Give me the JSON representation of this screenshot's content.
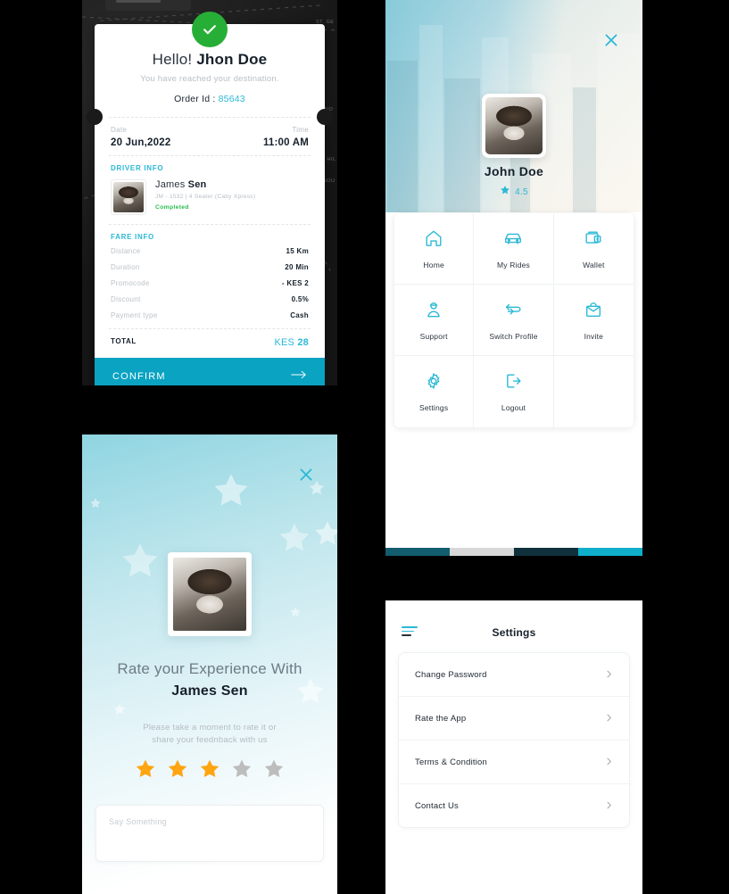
{
  "receipt": {
    "status_icon": "check-circle-icon",
    "greeting_light": "Hello!",
    "greeting_name": "Jhon Doe",
    "subtitle": "You have reached your destination.",
    "order_label": "Order Id :",
    "order_value": "85643",
    "date_label": "Date",
    "date_value": "20 Jun,2022",
    "time_label": "Time",
    "time_value": "11:00 AM",
    "driver_section_title": "DRIVER INFO",
    "driver_first": "James",
    "driver_last": "Sen",
    "driver_meta": "JM - 1532  |  4 Seater (Caby Xpress)",
    "driver_status": "Completed",
    "fare_section_title": "FARE INFO",
    "fare_rows": [
      {
        "label": "Distance",
        "value": "15 Km"
      },
      {
        "label": "Duration",
        "value": "20 Min"
      },
      {
        "label": "Promocode",
        "value": "- KES  2"
      },
      {
        "label": "Discount",
        "value": "0.5%"
      },
      {
        "label": "Payment type",
        "value": "Cash"
      }
    ],
    "total_label": "TOTAL",
    "total_currency": "KES",
    "total_amount": "28",
    "confirm_label": "CONFIRM",
    "map_labels": [
      "ST. GE",
      "N HIL",
      "SOU",
      "NO"
    ],
    "accent_color": "#2bb8d6",
    "confirm_bg": "#0aa3c2",
    "success_color": "#27ae36"
  },
  "profile": {
    "close_icon": "close-icon",
    "avatar_name": "avatar",
    "name": "John Doe",
    "rating_icon": "star-icon",
    "rating": "4.5",
    "menu": [
      {
        "icon": "home-icon",
        "label": "Home"
      },
      {
        "icon": "car-icon",
        "label": "My Rides"
      },
      {
        "icon": "wallet-icon",
        "label": "Wallet"
      },
      {
        "icon": "support-agent-icon",
        "label": "Support"
      },
      {
        "icon": "swap-icon",
        "label": "Switch Profile"
      },
      {
        "icon": "envelope-icon",
        "label": "Invite"
      },
      {
        "icon": "gear-icon",
        "label": "Settings"
      },
      {
        "icon": "logout-icon",
        "label": "Logout"
      }
    ],
    "palette": [
      "#135d6e",
      "#d8d8d8",
      "#10303c",
      "#0fafcc"
    ],
    "accent_color": "#2bb8d6"
  },
  "rate": {
    "close_icon": "close-icon",
    "heading_line1": "Rate your Experience",
    "heading_line2": "With",
    "heading_name": "James Sen",
    "sub_line1": "Please take a moment to rate it or",
    "sub_line2": "share your feednback with us",
    "stars_total": 5,
    "stars_filled": 3,
    "star_filled_color": "#FFA511",
    "star_empty_color": "#BDBDBD",
    "feedback_placeholder": "Say Something",
    "feedback_value": ""
  },
  "settings": {
    "menu_icon": "hamburger-icon",
    "title": "Settings",
    "items": [
      {
        "label": "Change Password",
        "chevron": "chevron-right-icon"
      },
      {
        "label": "Rate the App",
        "chevron": "chevron-right-icon"
      },
      {
        "label": "Terms & Condition",
        "chevron": "chevron-right-icon"
      },
      {
        "label": "Contact Us",
        "chevron": "chevron-right-icon"
      }
    ]
  }
}
